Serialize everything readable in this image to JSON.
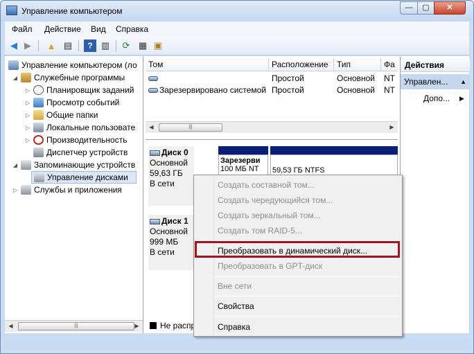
{
  "window": {
    "title": "Управление компьютером",
    "min_label": "—",
    "max_label": "▢",
    "close_label": "✕"
  },
  "menu": {
    "file": "Файл",
    "action": "Действие",
    "view": "Вид",
    "help": "Справка"
  },
  "tree": {
    "root": "Управление компьютером (ло",
    "utilities": "Служебные программы",
    "scheduler": "Планировщик заданий",
    "events": "Просмотр событий",
    "shared": "Общие папки",
    "users": "Локальные пользовате",
    "performance": "Производительность",
    "devices": "Диспетчер устройств",
    "storage": "Запоминающие устройств",
    "diskmgmt": "Управление дисками",
    "services": "Службы и приложения"
  },
  "volumes": {
    "headers": [
      "Том",
      "Расположение",
      "Тип",
      "Фа"
    ],
    "rows": [
      {
        "name": "",
        "layout": "Простой",
        "type": "Основной",
        "fs": "NT"
      },
      {
        "name": "Зарезервировано системой",
        "layout": "Простой",
        "type": "Основной",
        "fs": "NT"
      }
    ]
  },
  "disks": [
    {
      "title": "Диск 0",
      "type": "Основной",
      "size": "59,63 ГБ",
      "status": "В сети",
      "part1": "Зарезерви",
      "part1_sub": "100 МБ NT",
      "part2_sub": "59,53 ГБ NTFS"
    },
    {
      "title": "Диск 1",
      "type": "Основной",
      "size": "999 МБ",
      "status": "В сети"
    }
  ],
  "legend": {
    "unallocated": "Не распр"
  },
  "actions": {
    "header": "Действия",
    "selected": "Управлен...",
    "more": "Допо..."
  },
  "context_menu": {
    "items": [
      "Создать составной том...",
      "Создать чередующийся том...",
      "Создать зеркальный том...",
      "Создать том RAID-5...",
      "Преобразовать в динамический диск...",
      "Преобразовать в GPT-диск",
      "Вне сети",
      "Свойства",
      "Справка"
    ]
  },
  "colors": {
    "partition_bar": "#0a1e7a",
    "highlight_box": "#a1141c",
    "selection": "#dbe7f7"
  }
}
